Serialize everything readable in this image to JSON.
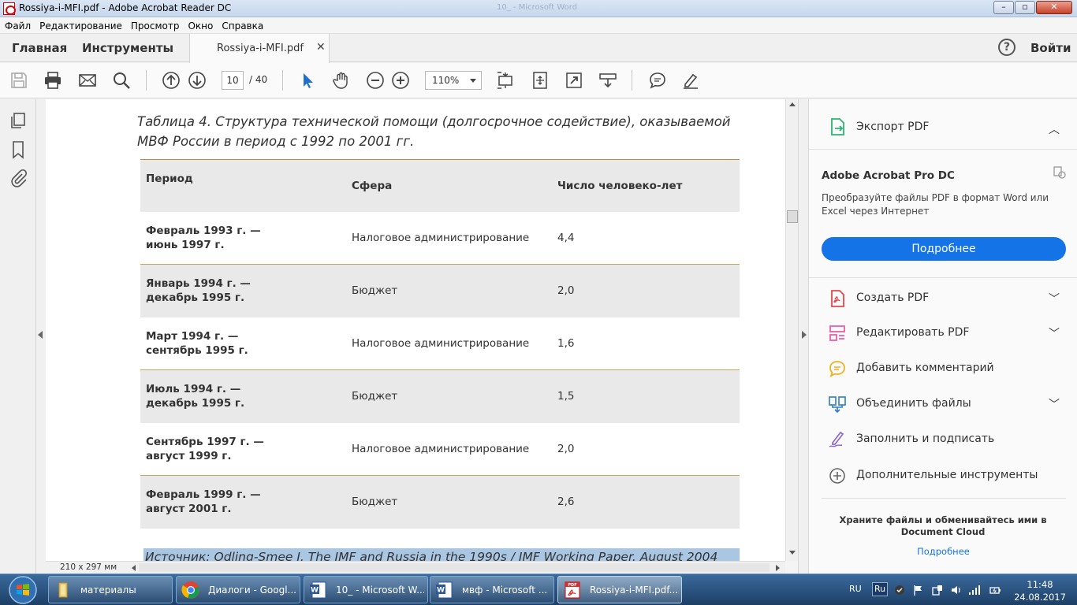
{
  "window": {
    "title": "Rossiya-i-MFI.pdf - Adobe Acrobat Reader DC",
    "ghost_title": "10_ - Microsoft Word"
  },
  "menu": [
    "Файл",
    "Редактирование",
    "Просмотр",
    "Окно",
    "Справка"
  ],
  "tabs": {
    "home": "Главная",
    "tools": "Инструменты",
    "document": "Rossiya-i-MFI.pdf",
    "signin": "Войти"
  },
  "toolbar": {
    "page_current": "10",
    "page_total": "/ 40",
    "zoom": "110%"
  },
  "document": {
    "caption": "Таблица 4. Структура технической помощи (долгосрочное содействие), оказываемой МВФ России в период с 1992 по 2001 гг.",
    "columns": [
      "Период",
      "Сфера",
      "Число человеко-лет"
    ],
    "rows": [
      {
        "period_1": "Февраль 1993 г. —",
        "period_2": "июнь 1997 г.",
        "sphere": "Налоговое администрирование",
        "value": "4,4"
      },
      {
        "period_1": "Январь 1994 г. —",
        "period_2": "декабрь 1995 г.",
        "sphere": "Бюджет",
        "value": "2,0"
      },
      {
        "period_1": "Март 1994 г. —",
        "period_2": "сентябрь 1995 г.",
        "sphere": "Налоговое администрирование",
        "value": "1,6"
      },
      {
        "period_1": "Июль 1994 г. —",
        "period_2": "декабрь 1995 г.",
        "sphere": "Бюджет",
        "value": "1,5"
      },
      {
        "period_1": "Сентябрь 1997 г. —",
        "period_2": "август 1999 г.",
        "sphere": "Налоговое администрирование",
        "value": "2,0"
      },
      {
        "period_1": "Февраль 1999 г. —",
        "period_2": "август 2001 г.",
        "sphere": "Бюджет",
        "value": "2,6"
      }
    ],
    "source": "Источник: Odling-Smee J. The IMF and Russia in the 1990s / IMF Working Paper. August 2004",
    "page_size": "210 x 297 мм"
  },
  "right_panel": {
    "export": "Экспорт PDF",
    "promo_title": "Adobe Acrobat Pro DC",
    "promo_text": "Преобразуйте файлы PDF в формат Word или Excel через Интернет",
    "promo_button": "Подробнее",
    "tools": [
      {
        "label": "Создать PDF",
        "icon": "create-pdf-icon",
        "color": "#e8464a"
      },
      {
        "label": "Редактировать PDF",
        "icon": "edit-pdf-icon",
        "color": "#e85fa8"
      },
      {
        "label": "Добавить комментарий",
        "icon": "comment-icon",
        "color": "#f2b01e"
      },
      {
        "label": "Объединить файлы",
        "icon": "combine-files-icon",
        "color": "#2a7ecb"
      },
      {
        "label": "Заполнить и подписать",
        "icon": "fill-sign-icon",
        "color": "#8c6ad6"
      },
      {
        "label": "Дополнительные инструменты",
        "icon": "more-tools-icon",
        "color": "#666666"
      }
    ],
    "cloud_text": "Храните файлы и обменивайтесь ими в Document Cloud",
    "cloud_link": "Подробнее"
  },
  "taskbar": {
    "items": [
      {
        "label": "материалы",
        "icon": "folder-icon"
      },
      {
        "label": "Диалоги - Googl...",
        "icon": "chrome-icon"
      },
      {
        "label": "10_ - Microsoft W...",
        "icon": "word-icon"
      },
      {
        "label": "мвф - Microsoft ...",
        "icon": "word-icon"
      },
      {
        "label": "Rossiya-i-MFI.pdf...",
        "icon": "pdf-icon"
      }
    ],
    "lang": "RU",
    "lang_badge": "Ru",
    "time": "11:48",
    "date": "24.08.2017"
  },
  "colors": {
    "accent": "#1473e6",
    "table_rule": "#c9a45a",
    "row_shade": "#e9e9e9",
    "highlight": "#a9c6e3"
  }
}
